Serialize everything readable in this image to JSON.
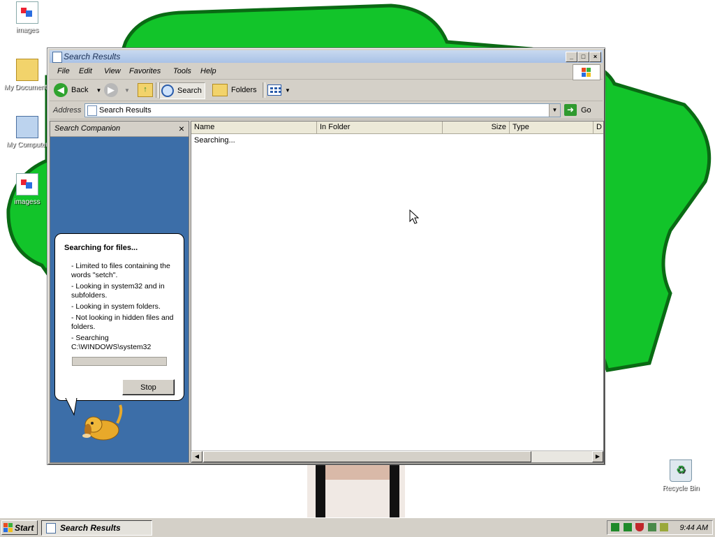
{
  "desktop": {
    "icons": [
      {
        "label": "images",
        "icon": "image-file-icon"
      },
      {
        "label": "My Documents",
        "icon": "my-documents-icon"
      },
      {
        "label": "My Computer",
        "icon": "my-computer-icon"
      },
      {
        "label": "imagess",
        "icon": "image-file-icon"
      },
      {
        "label": "Recycle Bin",
        "icon": "recycle-bin-icon"
      }
    ],
    "colors": {
      "tree_green": "#12c42a",
      "tree_outline": "#0a6a14"
    }
  },
  "window": {
    "title": "Search Results",
    "controls": {
      "minimize": "_",
      "maximize": "□",
      "close": "×"
    },
    "menu": [
      "File",
      "Edit",
      "View",
      "Favorites",
      "Tools",
      "Help"
    ],
    "toolbar": {
      "back": "Back",
      "search": "Search",
      "folders": "Folders"
    },
    "address": {
      "label": "Address",
      "value": "Search Results",
      "go": "Go"
    }
  },
  "companion": {
    "title": "Search Companion",
    "close": "×",
    "balloon": {
      "heading": "Searching for files...",
      "lines": [
        "- Limited to files containing the words \"setch\".",
        "- Looking in system32 and in subfolders.",
        "- Looking in system folders.",
        "- Not looking in hidden files and folders.",
        "- Searching C:\\WINDOWS\\system32"
      ],
      "stop": "Stop",
      "progress": 0.0
    }
  },
  "results": {
    "columns": [
      "Name",
      "In Folder",
      "Size",
      "Type",
      "D"
    ],
    "status": "Searching..."
  },
  "taskbar": {
    "start": "Start",
    "task": "Search Results",
    "clock": "9:44 AM"
  }
}
